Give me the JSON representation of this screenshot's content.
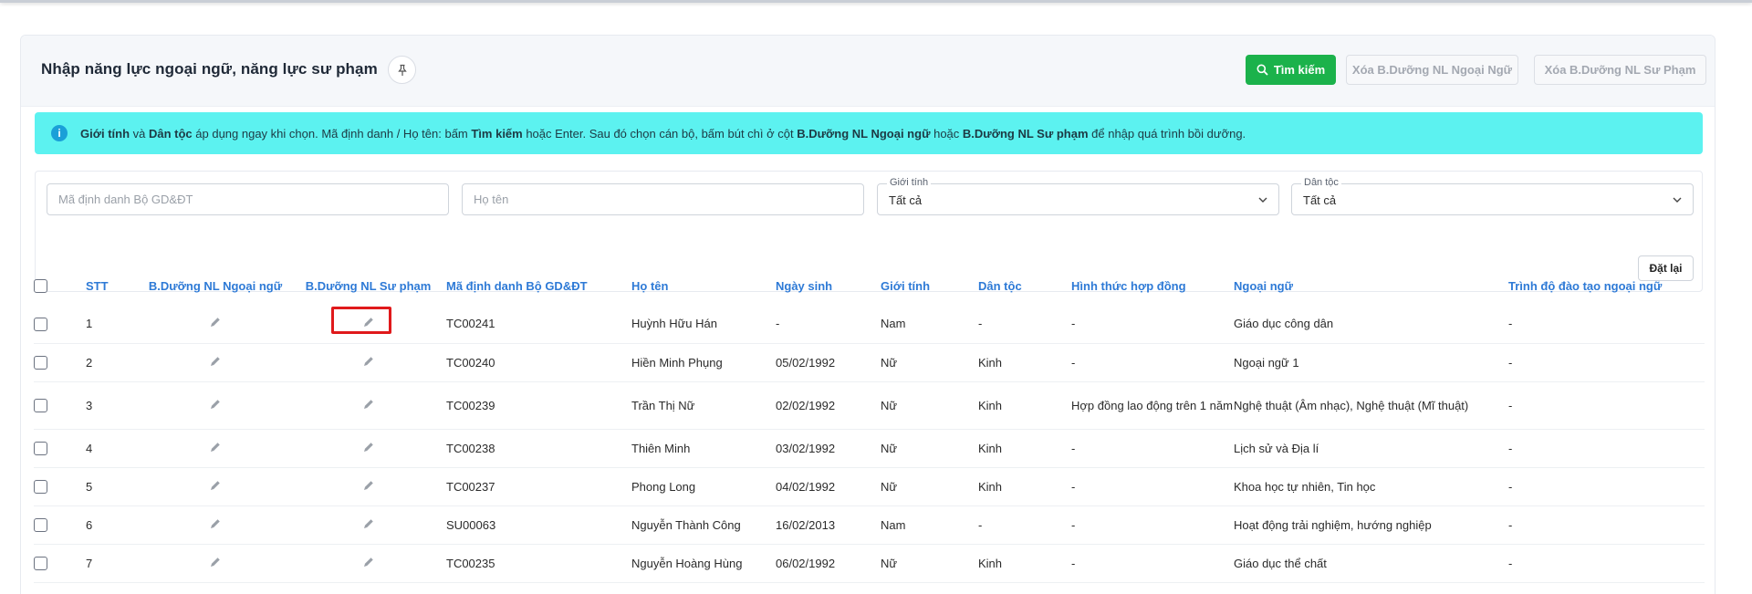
{
  "header": {
    "title": "Nhập năng lực ngoại ngữ, năng lực sư phạm",
    "pin_icon": "pin-icon",
    "search_button": "Tìm kiếm",
    "delete_nn_button": "Xóa B.Dưỡng NL Ngoại Ngữ",
    "delete_sp_button": "Xóa B.Dưỡng NL Sư Phạm"
  },
  "info": {
    "icon": "info-icon",
    "p1": "Giới tính",
    "p2": " và ",
    "p3": "Dân tộc",
    "p4": " áp dụng ngay khi chọn. Mã định danh / Họ tên: bấm ",
    "p5": "Tìm kiếm",
    "p6": " hoặc Enter. Sau đó chọn cán bộ, bấm bút chì ở cột ",
    "p7": "B.Dưỡng NL Ngoại ngữ",
    "p8": " hoặc ",
    "p9": "B.Dưỡng NL Sư phạm",
    "p10": " để nhập quá trình bồi dưỡng."
  },
  "filters": {
    "id_placeholder": "Mã định danh Bộ GD&ĐT",
    "name_placeholder": "Họ tên",
    "gender_label": "Giới tính",
    "gender_value": "Tất cả",
    "ethnic_label": "Dân tộc",
    "ethnic_value": "Tất cả",
    "reset_button": "Đặt lại"
  },
  "table": {
    "columns": [
      "STT",
      "B.Dưỡng NL Ngoại ngữ",
      "B.Dưỡng NL Sư phạm",
      "Mã định danh Bộ GD&ĐT",
      "Họ tên",
      "Ngày sinh",
      "Giới tính",
      "Dân tộc",
      "Hình thức hợp đồng",
      "Ngoại ngữ",
      "Trình độ đào tạo ngoại ngữ"
    ],
    "rows": [
      {
        "stt": "1",
        "id": "TC00241",
        "name": "Huỳnh Hữu Hán",
        "dob": "-",
        "gender": "Nam",
        "ethnic": "-",
        "contract": "-",
        "language": "Giáo dục công dân",
        "level": "-"
      },
      {
        "stt": "2",
        "id": "TC00240",
        "name": "Hiền Minh Phụng",
        "dob": "05/02/1992",
        "gender": "Nữ",
        "ethnic": "Kinh",
        "contract": "-",
        "language": "Ngoại ngữ 1",
        "level": "-"
      },
      {
        "stt": "3",
        "id": "TC00239",
        "name": "Trần Thị Nữ",
        "dob": "02/02/1992",
        "gender": "Nữ",
        "ethnic": "Kinh",
        "contract": "Hợp đồng lao động trên 1 năm",
        "language": "Nghệ thuật (Âm nhạc), Nghệ thuật (Mĩ thuật)",
        "level": "-"
      },
      {
        "stt": "4",
        "id": "TC00238",
        "name": "Thiên Minh",
        "dob": "03/02/1992",
        "gender": "Nữ",
        "ethnic": "Kinh",
        "contract": "-",
        "language": "Lịch sử và Địa lí",
        "level": "-"
      },
      {
        "stt": "5",
        "id": "TC00237",
        "name": "Phong Long",
        "dob": "04/02/1992",
        "gender": "Nữ",
        "ethnic": "Kinh",
        "contract": "-",
        "language": "Khoa học tự nhiên, Tin học",
        "level": "-"
      },
      {
        "stt": "6",
        "id": "SU00063",
        "name": "Nguyễn Thành Công",
        "dob": "16/02/2013",
        "gender": "Nam",
        "ethnic": "-",
        "contract": "-",
        "language": "Hoạt động trải nghiệm, hướng nghiệp",
        "level": "-"
      },
      {
        "stt": "7",
        "id": "TC00235",
        "name": "Nguyễn Hoàng Hùng",
        "dob": "06/02/1992",
        "gender": "Nữ",
        "ethnic": "Kinh",
        "contract": "-",
        "language": "Giáo dục thể chất",
        "level": "-"
      }
    ]
  },
  "colors": {
    "accent": "#2e7ad6",
    "search_green": "#1bb24b",
    "info_bg": "#5cf2f0",
    "highlight": "#e0191b"
  }
}
